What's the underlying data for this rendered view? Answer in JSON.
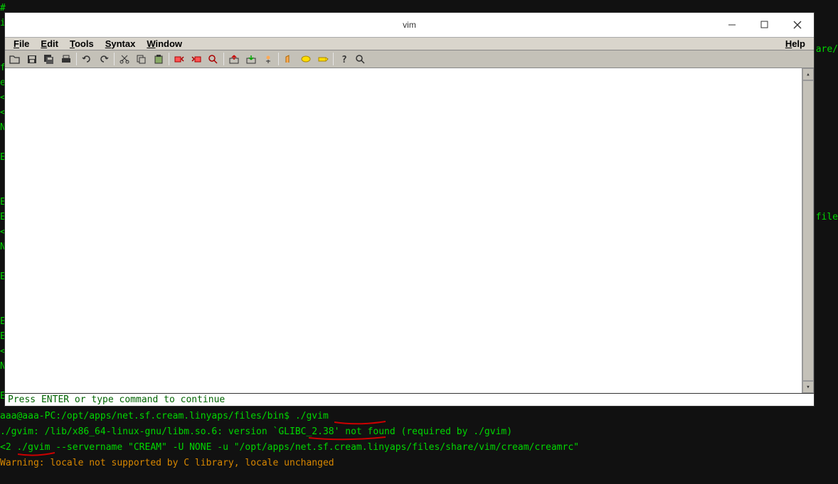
{
  "bg_left_chars": [
    "#",
    "i",
    "",
    "",
    "f",
    "e",
    "<",
    "<",
    "N",
    "",
    "E",
    "",
    "",
    "",
    "E",
    "E",
    "<",
    "N",
    "",
    "E",
    "",
    "",
    "",
    "E",
    "E",
    "<",
    "N"
  ],
  "bg_right_chars_top": "are/",
  "bg_right_chars_mid": "file",
  "window": {
    "title": "vim",
    "controls": {
      "minimize": "—",
      "maximize": "☐",
      "close": "✕"
    }
  },
  "menu": {
    "file": "File",
    "edit": "Edit",
    "tools": "Tools",
    "syntax": "Syntax",
    "window": "Window",
    "help": "Help"
  },
  "toolbar_icons": [
    {
      "name": "open-icon",
      "group": 0
    },
    {
      "name": "save-icon",
      "group": 0
    },
    {
      "name": "saveall-icon",
      "group": 0
    },
    {
      "name": "print-icon",
      "group": 0
    },
    {
      "name": "undo-icon",
      "group": 1
    },
    {
      "name": "redo-icon",
      "group": 1
    },
    {
      "name": "cut-icon",
      "group": 2
    },
    {
      "name": "copy-icon",
      "group": 2
    },
    {
      "name": "paste-icon",
      "group": 2
    },
    {
      "name": "find-icon",
      "group": 3
    },
    {
      "name": "findnext-icon",
      "group": 3
    },
    {
      "name": "replace-icon",
      "group": 3
    },
    {
      "name": "session-load-icon",
      "group": 4
    },
    {
      "name": "session-save-icon",
      "group": 4
    },
    {
      "name": "run-icon",
      "group": 4
    },
    {
      "name": "make-icon",
      "group": 5
    },
    {
      "name": "tag-icon",
      "group": 5
    },
    {
      "name": "ctags-icon",
      "group": 5
    },
    {
      "name": "help-icon",
      "group": 6
    },
    {
      "name": "findhelp-icon",
      "group": 6
    }
  ],
  "status": "Press ENTER or type command to continue",
  "terminal": {
    "line1_prompt": "aaa@aaa-PC:/opt/apps/net.sf.cream.linyaps/files/bin$",
    "line1_cmd": "./gvim",
    "line2": "./gvim: /lib/x86_64-linux-gnu/libm.so.6: version `GLIBC_2.38' not found (required by ./gvim)",
    "line3": "<2 ./gvim --servername \"CREAM\" -U NONE -u \"/opt/apps/net.sf.cream.linyaps/files/share/vim/cream/creamrc\"",
    "line4": "Warning: locale not supported by C library, locale unchanged"
  }
}
